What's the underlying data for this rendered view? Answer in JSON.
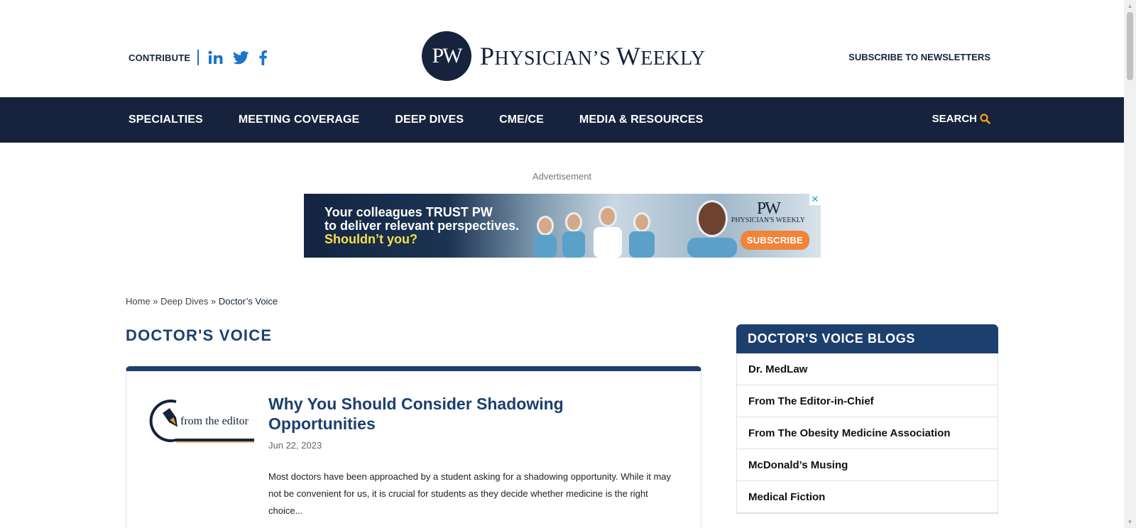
{
  "header": {
    "contribute": "CONTRIBUTE",
    "logo_monogram": "PW",
    "logo_name_p": "P",
    "logo_name_hysician": "HYSICIAN",
    "logo_name_s": "’S ",
    "logo_name_w": "W",
    "logo_name_eekly": "EEKLY",
    "subscribe_newsletters": "SUBSCRIBE TO NEWSLETTERS"
  },
  "nav": {
    "items": [
      {
        "label": "SPECIALTIES"
      },
      {
        "label": "MEETING COVERAGE"
      },
      {
        "label": "DEEP DIVES"
      },
      {
        "label": "CME/CE"
      },
      {
        "label": "MEDIA & RESOURCES"
      }
    ],
    "search_label": "SEARCH"
  },
  "ad": {
    "label": "Advertisement",
    "line1": "Your colleagues TRUST PW",
    "line2": "to deliver relevant perspectives.",
    "line3": "Shouldn’t you?",
    "logo_mark": "PW",
    "logo_name": "PHYSICIAN'S WEEKLY",
    "cta": "SUBSCRIBE",
    "close": "✕"
  },
  "breadcrumb": {
    "home": "Home",
    "sep1": " » ",
    "deep_dives": "Deep Dives",
    "sep2": " » ",
    "current": "Doctor’s Voice"
  },
  "page_title": "DOCTOR'S VOICE",
  "article": {
    "thumb_text": "from the editor",
    "title": "Why You Should Consider Shadowing Opportunities",
    "date": "Jun 22, 2023",
    "excerpt": "Most doctors have been approached by a student asking for a shadowing opportunity. While it may not be convenient for us, it is crucial for students as they decide whether medicine is the right choice..."
  },
  "sidebar": {
    "title": "DOCTOR'S VOICE BLOGS",
    "items": [
      {
        "label": "Dr. MedLaw"
      },
      {
        "label": "From The Editor-in-Chief"
      },
      {
        "label": "From The Obesity Medicine Association"
      },
      {
        "label": "McDonald’s Musing"
      },
      {
        "label": "Medical Fiction"
      }
    ]
  },
  "colors": {
    "navy": "#17233d",
    "title_blue": "#1d3f6e",
    "link_blue": "#1d75c8",
    "search_orange": "#f2a026",
    "cta_orange": "#f0843a"
  },
  "icons": [
    "linkedin-icon",
    "twitter-icon",
    "facebook-icon",
    "search-icon",
    "close-icon",
    "pen-icon"
  ]
}
